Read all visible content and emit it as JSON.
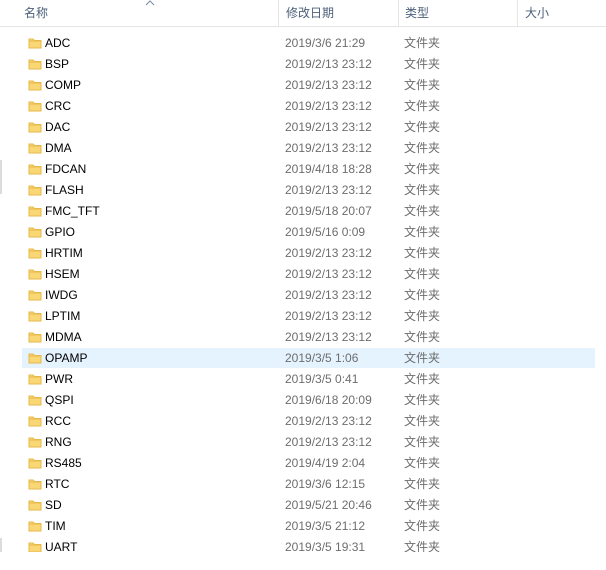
{
  "columns": {
    "name": "名称",
    "date": "修改日期",
    "type": "类型",
    "size": "大小"
  },
  "sort_icon": "sort-up-icon",
  "folder_icon": "folder-icon",
  "items": [
    {
      "name": "ADC",
      "date": "2019/3/6 21:29",
      "type": "文件夹"
    },
    {
      "name": "BSP",
      "date": "2019/2/13 23:12",
      "type": "文件夹"
    },
    {
      "name": "COMP",
      "date": "2019/2/13 23:12",
      "type": "文件夹"
    },
    {
      "name": "CRC",
      "date": "2019/2/13 23:12",
      "type": "文件夹"
    },
    {
      "name": "DAC",
      "date": "2019/2/13 23:12",
      "type": "文件夹"
    },
    {
      "name": "DMA",
      "date": "2019/2/13 23:12",
      "type": "文件夹"
    },
    {
      "name": "FDCAN",
      "date": "2019/4/18 18:28",
      "type": "文件夹"
    },
    {
      "name": "FLASH",
      "date": "2019/2/13 23:12",
      "type": "文件夹"
    },
    {
      "name": "FMC_TFT",
      "date": "2019/5/18 20:07",
      "type": "文件夹"
    },
    {
      "name": "GPIO",
      "date": "2019/5/16 0:09",
      "type": "文件夹"
    },
    {
      "name": "HRTIM",
      "date": "2019/2/13 23:12",
      "type": "文件夹"
    },
    {
      "name": "HSEM",
      "date": "2019/2/13 23:12",
      "type": "文件夹"
    },
    {
      "name": "IWDG",
      "date": "2019/2/13 23:12",
      "type": "文件夹"
    },
    {
      "name": "LPTIM",
      "date": "2019/2/13 23:12",
      "type": "文件夹"
    },
    {
      "name": "MDMA",
      "date": "2019/2/13 23:12",
      "type": "文件夹"
    },
    {
      "name": "OPAMP",
      "date": "2019/3/5 1:06",
      "type": "文件夹",
      "hover": true
    },
    {
      "name": "PWR",
      "date": "2019/3/5 0:41",
      "type": "文件夹"
    },
    {
      "name": "QSPI",
      "date": "2019/6/18 20:09",
      "type": "文件夹"
    },
    {
      "name": "RCC",
      "date": "2019/2/13 23:12",
      "type": "文件夹"
    },
    {
      "name": "RNG",
      "date": "2019/2/13 23:12",
      "type": "文件夹"
    },
    {
      "name": "RS485",
      "date": "2019/4/19 2:04",
      "type": "文件夹"
    },
    {
      "name": "RTC",
      "date": "2019/3/6 12:15",
      "type": "文件夹"
    },
    {
      "name": "SD",
      "date": "2019/5/21 20:46",
      "type": "文件夹"
    },
    {
      "name": "TIM",
      "date": "2019/3/5 21:12",
      "type": "文件夹"
    },
    {
      "name": "UART",
      "date": "2019/3/5 19:31",
      "type": "文件夹"
    }
  ]
}
